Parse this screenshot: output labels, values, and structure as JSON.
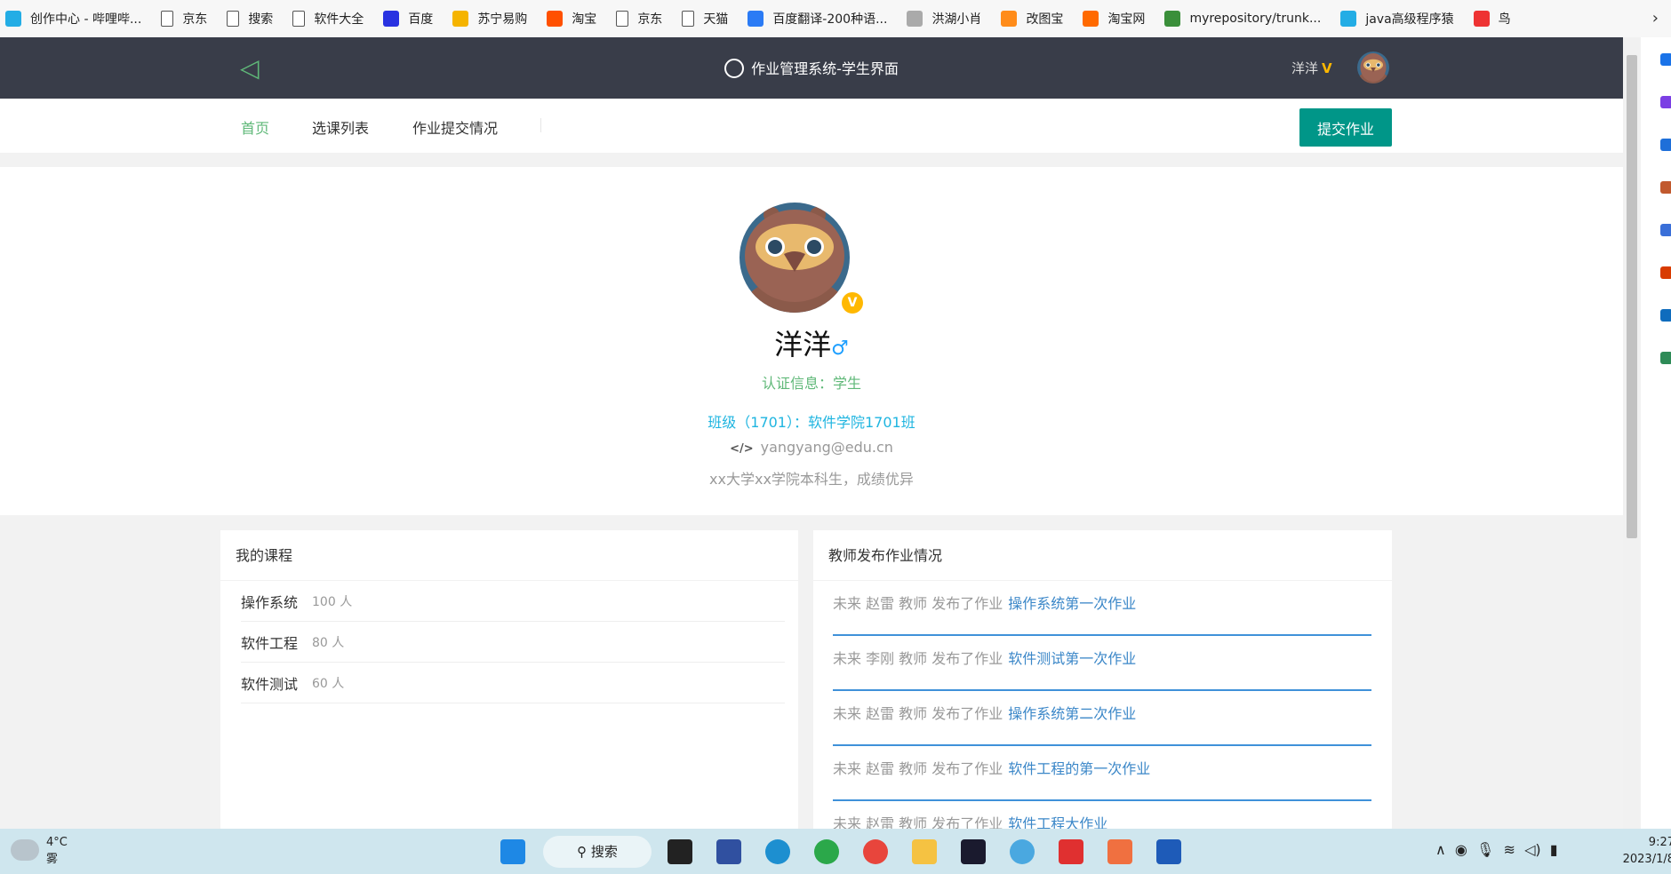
{
  "bookmarks": [
    {
      "label": "创作中心 - 哔哩哔...",
      "color": "#23ade5"
    },
    {
      "label": "京东",
      "color": "doc"
    },
    {
      "label": "搜索",
      "color": "doc"
    },
    {
      "label": "软件大全",
      "color": "doc"
    },
    {
      "label": "百度",
      "color": "#2932e1"
    },
    {
      "label": "苏宁易购",
      "color": "#f5b400"
    },
    {
      "label": "淘宝",
      "color": "#ff5000"
    },
    {
      "label": "京东",
      "color": "doc"
    },
    {
      "label": "天猫",
      "color": "doc"
    },
    {
      "label": "百度翻译-200种语...",
      "color": "#2b7bf5"
    },
    {
      "label": "洪湖小肖",
      "color": "#aaa"
    },
    {
      "label": "改图宝",
      "color": "#ff8c1a"
    },
    {
      "label": "淘宝网",
      "color": "#ff6a00"
    },
    {
      "label": "myrepository/trunk...",
      "color": "#3a8f3a"
    },
    {
      "label": "java高级程序猿",
      "color": "#23ade5"
    },
    {
      "label": "鸟",
      "color": "#e33"
    }
  ],
  "header": {
    "title": "作业管理系统-学生界面",
    "username": "洋洋",
    "vip": "V"
  },
  "nav": {
    "items": [
      "首页",
      "选课列表",
      "作业提交情况"
    ],
    "active": 0,
    "submit": "提交作业"
  },
  "profile": {
    "name": "洋洋",
    "gender": "♂",
    "cert": "认证信息：学生",
    "class": "班级（1701）：软件学院1701班",
    "email": "yangyang@edu.cn",
    "bio": "xx大学xx学院本科生，成绩优异",
    "badge": "V"
  },
  "courses": {
    "title": "我的课程",
    "items": [
      {
        "name": "操作系统",
        "count": "100 人"
      },
      {
        "name": "软件工程",
        "count": "80 人"
      },
      {
        "name": "软件测试",
        "count": "60 人"
      }
    ]
  },
  "teacher": {
    "title": "教师发布作业情况",
    "items": [
      {
        "text": "未来 赵雷 教师 发布了作业",
        "link": "操作系统第一次作业"
      },
      {
        "text": "未来 李刚 教师 发布了作业",
        "link": "软件测试第一次作业"
      },
      {
        "text": "未来 赵雷 教师 发布了作业",
        "link": "操作系统第二次作业"
      },
      {
        "text": "未来 赵雷 教师 发布了作业",
        "link": "软件工程的第一次作业"
      },
      {
        "text": "未来 赵雷 教师 发布了作业",
        "link": "软件工程大作业"
      }
    ]
  },
  "taskbar": {
    "temp": "4°C",
    "weather": "雾",
    "search": "搜索",
    "time": "9:27",
    "date": "2023/1/8"
  },
  "colors": {
    "header": "#393d49",
    "accent": "#009688",
    "green": "#5fb878",
    "link": "#1fb5e0"
  }
}
